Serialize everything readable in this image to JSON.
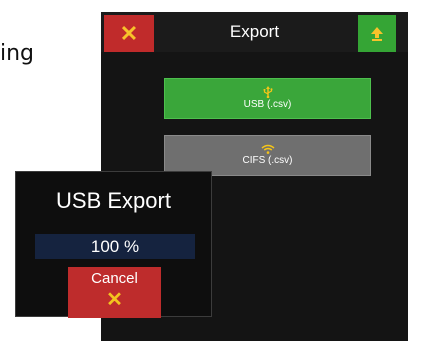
{
  "background_text": "ing",
  "header": {
    "close_icon": "✕",
    "title": "Export",
    "upload_icon": "upload-arrow"
  },
  "options": [
    {
      "label": "USB (.csv)",
      "icon": "usb-icon",
      "color": "#3aa63a"
    },
    {
      "label": "CIFS (.csv)",
      "icon": "wifi-icon",
      "color": "#6f6f6f"
    }
  ],
  "dialog": {
    "title": "USB Export",
    "progress_text": "100 %",
    "progress_value": 1.0,
    "cancel_label": "Cancel",
    "cancel_icon": "✕"
  },
  "colors": {
    "cancel_red": "#c02b2b",
    "accent_yellow": "#f7c22b",
    "confirm_green": "#35a535",
    "progress_bg": "#15233f"
  }
}
